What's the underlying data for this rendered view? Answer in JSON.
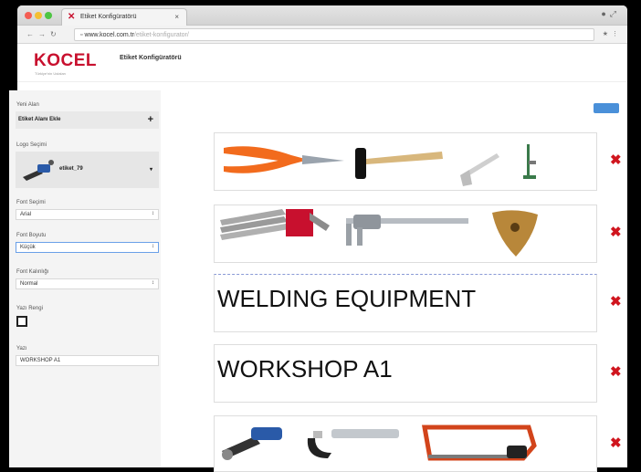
{
  "browser": {
    "tab_title": "Etiket Konfigüratörü",
    "url": "www.kocel.com.tr",
    "url_rest": "/etiket-konfigurator/"
  },
  "app": {
    "logo": "KOCEL",
    "logo_sub": "Türkiye'nin Ustaları",
    "page_title": "Etiket Konfigüratörü"
  },
  "sidebar": {
    "yeni_alan_label": "Yeni Alan",
    "add_field_label": "Etiket Alanı Ekle",
    "logo_label": "Logo Seçimi",
    "logo_value": "etiket_79",
    "font_label": "Font Seçimi",
    "font_value": "Arial",
    "size_label": "Font Boyutu",
    "size_value": "Küçük",
    "weight_label": "Font Kalınlığı",
    "weight_value": "Normal",
    "color_label": "Yazı Rengi",
    "text_label": "Yazı",
    "text_value": "WORKSHOP A1"
  },
  "labels": [
    {
      "type": "image",
      "items": [
        "pliers-icon",
        "hammer-icon",
        "angle-square-icon",
        "caliper-gauge-icon"
      ]
    },
    {
      "type": "image",
      "items": [
        "hex-key-set-icon",
        "vernier-caliper-icon",
        "insert-tip-icon"
      ]
    },
    {
      "type": "text",
      "text": "WELDING EQUIPMENT"
    },
    {
      "type": "text",
      "text": "WORKSHOP A1"
    },
    {
      "type": "image",
      "items": [
        "angle-grinder-icon",
        "micrometer-icon",
        "hacksaw-icon"
      ]
    }
  ],
  "colors": {
    "brand": "#c8102e",
    "delete": "#d0151e",
    "accent": "#4a90d9"
  }
}
